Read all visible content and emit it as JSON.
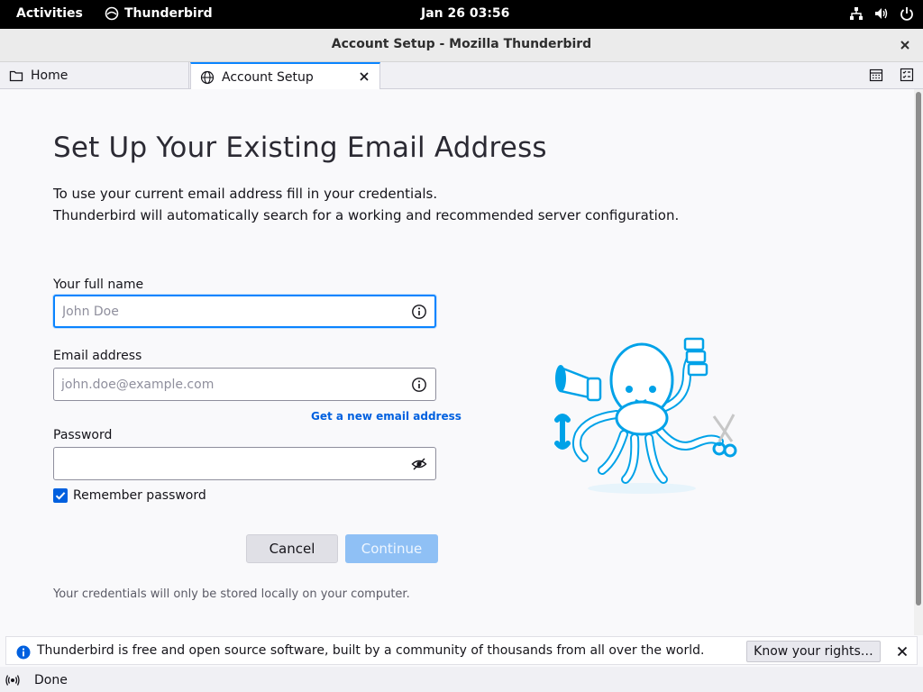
{
  "topbar": {
    "activities": "Activities",
    "app_name": "Thunderbird",
    "clock": "Jan 26  03:56",
    "icons": [
      "network-icon",
      "volume-icon",
      "power-icon"
    ]
  },
  "window": {
    "title": "Account Setup - Mozilla Thunderbird"
  },
  "tabs": [
    {
      "label": "Home",
      "icon": "folder-icon",
      "active": false
    },
    {
      "label": "Account Setup",
      "icon": "globe-icon",
      "active": true
    }
  ],
  "tabbar_icons": [
    "calendar-icon",
    "tasks-icon"
  ],
  "setup": {
    "heading": "Set Up Your Existing Email Address",
    "intro_line1": "To use your current email address fill in your credentials.",
    "intro_line2": "Thunderbird will automatically search for a working and recommended server configuration.",
    "name_label": "Your full name",
    "name_placeholder": "John Doe",
    "name_value": "",
    "email_label": "Email address",
    "email_placeholder": "john.doe@example.com",
    "email_value": "",
    "new_email_link": "Get a new email address",
    "password_label": "Password",
    "password_value": "",
    "remember_label": "Remember password",
    "remember_checked": true,
    "cancel_label": "Cancel",
    "continue_label": "Continue",
    "note": "Your credentials will only be stored locally on your computer."
  },
  "notification": {
    "message": "Thunderbird is free and open source software, built by a community of thousands from all over the world.",
    "rights_button": "Know your rights…"
  },
  "statusbar": {
    "status": "Done"
  },
  "colors": {
    "accent": "#0060df",
    "focus": "#0a84ff",
    "mascot": "#00a2e8"
  }
}
